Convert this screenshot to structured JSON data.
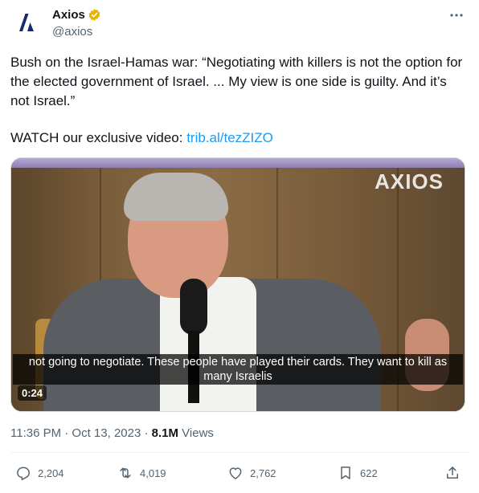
{
  "author": {
    "display_name": "Axios",
    "handle": "@axios",
    "verified_badge_color": "#e8b600"
  },
  "tweet": {
    "text": "Bush on the Israel-Hamas war: “Negotiating with killers is not the option for the elected government of Israel. ... My view is one side is guilty. And it’s not Israel.”",
    "watch_prefix": "WATCH our exclusive video: ",
    "link_text": "trib.al/tezZIZO"
  },
  "media": {
    "watermark": "AXIOS",
    "caption": "not going to negotiate. These people have played  their cards. They want to kill as many Israelis",
    "duration": "0:24"
  },
  "meta": {
    "time_date": "11:36 PM · Oct 13, 2023 · ",
    "views_count": "8.1M",
    "views_label": " Views"
  },
  "actions": {
    "replies": "2,204",
    "reposts": "4,019",
    "likes": "2,762",
    "bookmarks": "622"
  },
  "icons": [
    "axios-logo-icon",
    "verified-badge-icon",
    "more-icon",
    "reply-icon",
    "repost-icon",
    "like-icon",
    "bookmark-icon",
    "share-icon"
  ],
  "colors": {
    "link": "#1d9bf0",
    "secondary_text": "#536471"
  }
}
